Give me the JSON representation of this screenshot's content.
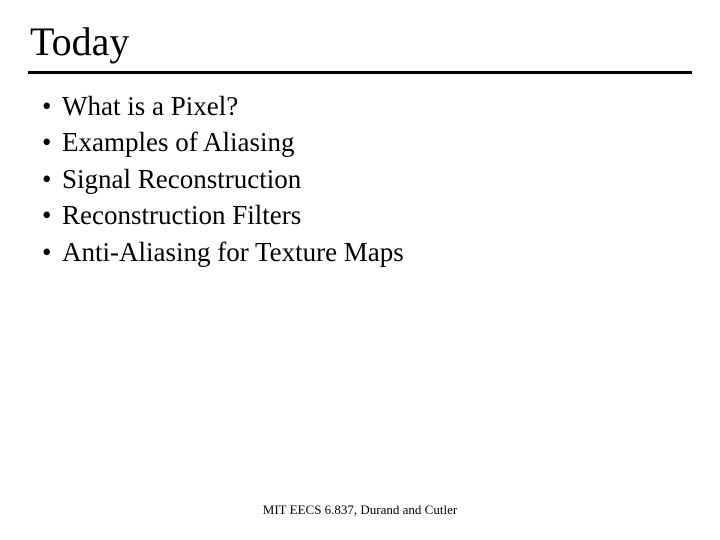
{
  "slide": {
    "title": "Today",
    "bullets": [
      "What is a Pixel?",
      "Examples of Aliasing",
      "Signal Reconstruction",
      "Reconstruction Filters",
      "Anti-Aliasing for Texture Maps"
    ],
    "footer": "MIT EECS 6.837, Durand and Cutler"
  }
}
